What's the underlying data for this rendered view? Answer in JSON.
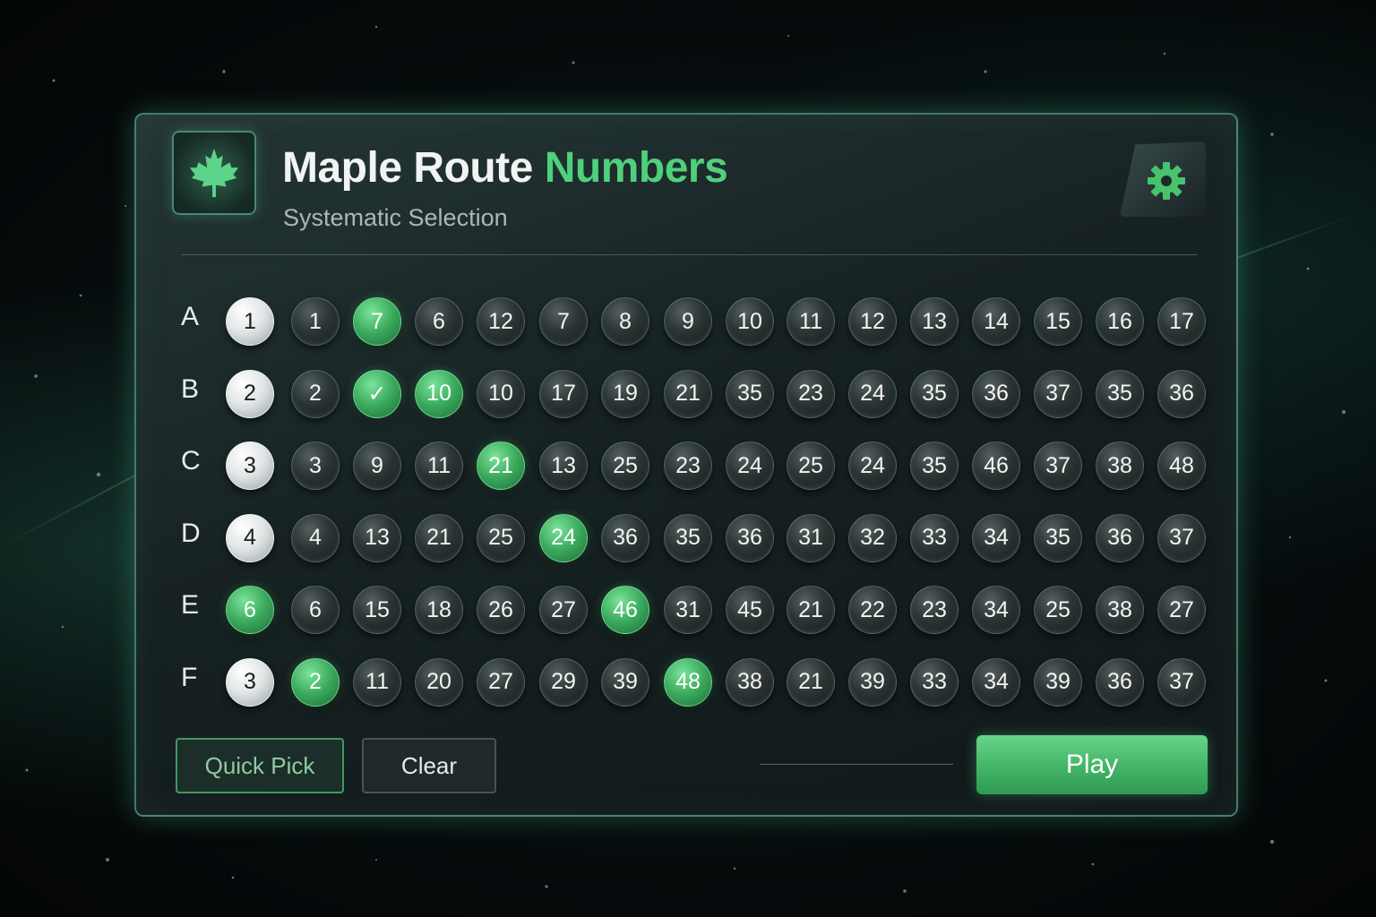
{
  "header": {
    "title_main": "Maple Route",
    "title_accent": "Numbers",
    "subtitle": "Systematic Selection",
    "logo_icon": "maple-leaf-icon",
    "settings_icon": "gear-icon"
  },
  "colors": {
    "accent_green": "#4fd07c",
    "panel_border": "#6ec8aa",
    "background": "#060b0c"
  },
  "grid": {
    "rows": [
      {
        "label": "A",
        "balls": [
          {
            "n": "1",
            "state": "white"
          },
          {
            "n": "1",
            "state": "dark"
          },
          {
            "n": "7",
            "state": "green"
          },
          {
            "n": "6",
            "state": "dark"
          },
          {
            "n": "12",
            "state": "dark"
          },
          {
            "n": "7",
            "state": "dark"
          },
          {
            "n": "8",
            "state": "dark"
          },
          {
            "n": "9",
            "state": "dark"
          },
          {
            "n": "10",
            "state": "dark"
          },
          {
            "n": "11",
            "state": "dark"
          },
          {
            "n": "12",
            "state": "dark"
          },
          {
            "n": "13",
            "state": "dark"
          },
          {
            "n": "14",
            "state": "dark"
          },
          {
            "n": "15",
            "state": "dark"
          },
          {
            "n": "16",
            "state": "dark"
          },
          {
            "n": "17",
            "state": "dark"
          }
        ]
      },
      {
        "label": "B",
        "balls": [
          {
            "n": "2",
            "state": "white"
          },
          {
            "n": "2",
            "state": "dark"
          },
          {
            "n": "✓",
            "state": "green"
          },
          {
            "n": "10",
            "state": "green"
          },
          {
            "n": "10",
            "state": "dark"
          },
          {
            "n": "17",
            "state": "dark"
          },
          {
            "n": "19",
            "state": "dark"
          },
          {
            "n": "21",
            "state": "dark"
          },
          {
            "n": "35",
            "state": "dark"
          },
          {
            "n": "23",
            "state": "dark"
          },
          {
            "n": "24",
            "state": "dark"
          },
          {
            "n": "35",
            "state": "dark"
          },
          {
            "n": "36",
            "state": "dark"
          },
          {
            "n": "37",
            "state": "dark"
          },
          {
            "n": "35",
            "state": "dark"
          },
          {
            "n": "36",
            "state": "dark"
          }
        ]
      },
      {
        "label": "C",
        "balls": [
          {
            "n": "3",
            "state": "white"
          },
          {
            "n": "3",
            "state": "dark"
          },
          {
            "n": "9",
            "state": "dark"
          },
          {
            "n": "11",
            "state": "dark"
          },
          {
            "n": "21",
            "state": "green"
          },
          {
            "n": "13",
            "state": "dark"
          },
          {
            "n": "25",
            "state": "dark"
          },
          {
            "n": "23",
            "state": "dark"
          },
          {
            "n": "24",
            "state": "dark"
          },
          {
            "n": "25",
            "state": "dark"
          },
          {
            "n": "24",
            "state": "dark"
          },
          {
            "n": "35",
            "state": "dark"
          },
          {
            "n": "46",
            "state": "dark"
          },
          {
            "n": "37",
            "state": "dark"
          },
          {
            "n": "38",
            "state": "dark"
          },
          {
            "n": "48",
            "state": "dark"
          }
        ]
      },
      {
        "label": "D",
        "balls": [
          {
            "n": "4",
            "state": "white"
          },
          {
            "n": "4",
            "state": "dark"
          },
          {
            "n": "13",
            "state": "dark"
          },
          {
            "n": "21",
            "state": "dark"
          },
          {
            "n": "25",
            "state": "dark"
          },
          {
            "n": "24",
            "state": "green"
          },
          {
            "n": "36",
            "state": "dark"
          },
          {
            "n": "35",
            "state": "dark"
          },
          {
            "n": "36",
            "state": "dark"
          },
          {
            "n": "31",
            "state": "dark"
          },
          {
            "n": "32",
            "state": "dark"
          },
          {
            "n": "33",
            "state": "dark"
          },
          {
            "n": "34",
            "state": "dark"
          },
          {
            "n": "35",
            "state": "dark"
          },
          {
            "n": "36",
            "state": "dark"
          },
          {
            "n": "37",
            "state": "dark"
          }
        ]
      },
      {
        "label": "E",
        "balls": [
          {
            "n": "6",
            "state": "green"
          },
          {
            "n": "6",
            "state": "dark"
          },
          {
            "n": "15",
            "state": "dark"
          },
          {
            "n": "18",
            "state": "dark"
          },
          {
            "n": "26",
            "state": "dark"
          },
          {
            "n": "27",
            "state": "dark"
          },
          {
            "n": "46",
            "state": "green"
          },
          {
            "n": "31",
            "state": "dark"
          },
          {
            "n": "45",
            "state": "dark"
          },
          {
            "n": "21",
            "state": "dark"
          },
          {
            "n": "22",
            "state": "dark"
          },
          {
            "n": "23",
            "state": "dark"
          },
          {
            "n": "34",
            "state": "dark"
          },
          {
            "n": "25",
            "state": "dark"
          },
          {
            "n": "38",
            "state": "dark"
          },
          {
            "n": "27",
            "state": "dark"
          }
        ]
      },
      {
        "label": "F",
        "balls": [
          {
            "n": "3",
            "state": "white"
          },
          {
            "n": "2",
            "state": "green"
          },
          {
            "n": "11",
            "state": "dark"
          },
          {
            "n": "20",
            "state": "dark"
          },
          {
            "n": "27",
            "state": "dark"
          },
          {
            "n": "29",
            "state": "dark"
          },
          {
            "n": "39",
            "state": "dark"
          },
          {
            "n": "48",
            "state": "green"
          },
          {
            "n": "38",
            "state": "dark"
          },
          {
            "n": "21",
            "state": "dark"
          },
          {
            "n": "39",
            "state": "dark"
          },
          {
            "n": "33",
            "state": "dark"
          },
          {
            "n": "34",
            "state": "dark"
          },
          {
            "n": "39",
            "state": "dark"
          },
          {
            "n": "36",
            "state": "dark"
          },
          {
            "n": "37",
            "state": "dark"
          }
        ]
      }
    ]
  },
  "actions": {
    "quick_pick": "Quick Pick",
    "clear": "Clear",
    "play": "Play"
  }
}
